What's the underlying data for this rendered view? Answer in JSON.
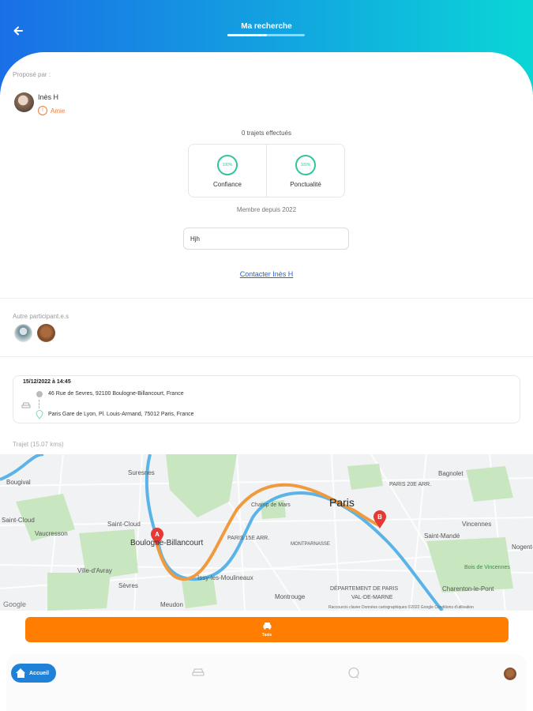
{
  "header": {
    "title": "Ma recherche",
    "back_icon": "arrow-left-icon"
  },
  "proposer": {
    "label": "Proposé par :",
    "name": "Inès H",
    "tag": "Amie",
    "tag_color": "#f07a3a"
  },
  "stats": {
    "trips_done": "0 trajets effectués",
    "items": [
      {
        "value": "100%",
        "label": "Confiance"
      },
      {
        "value": "100%",
        "label": "Ponctualité"
      }
    ],
    "member_since": "Membre depuis 2022"
  },
  "message": {
    "value": "Hjh"
  },
  "contact": {
    "label": "Contacter Inès H"
  },
  "participants": {
    "label": "Autre participant.e.s"
  },
  "trip": {
    "datetime": "15/12/2022 à 14:45",
    "from": "46 Rue de Sevres, 92100 Boulogne-Billancourt, France",
    "to": "Paris Gare de Lyon, Pl. Louis-Armand, 75012 Paris, France",
    "route_label": "Trajet (15.07 kms)"
  },
  "map": {
    "labels": {
      "bougival": "Bougival",
      "suresnes": "Suresnes",
      "saint_cloud": "Saint-Cloud",
      "vaucresson": "Vaucresson",
      "boulogne": "Boulogne-Billancourt",
      "ville_davray": "Ville-d'Avray",
      "sevres": "Sèvres",
      "meudon": "Meudon",
      "issy": "Issy-les-Moulineaux",
      "champ_de_mars": "Champ de Mars",
      "paris": "Paris",
      "paris15": "PARIS 15E ARR.",
      "paris20": "PARIS 20E ARR.",
      "bagnolet": "Bagnolet",
      "vincennes": "Vincennes",
      "saint_mande": "Saint-Mandé",
      "nogent": "Nogent-",
      "charenton": "Charenton-le-Pont",
      "dept": "DÉPARTEMENT DE PARIS",
      "montrouge": "Montrouge",
      "montparnasse": "MONTPARNASSE",
      "bois_vincennes": "Bois de Vincennes",
      "val_de_marne": "VAL-DE-MARNE",
      "footer": "Raccourcis clavier   Données cartographiques ©2022 Google   Conditions d'utilisation",
      "google": "Google"
    },
    "marker_a": "A",
    "marker_b": "B",
    "route_color": "#f09a3e",
    "water_color": "#5ab4e8",
    "park_color": "#c8e6c0"
  },
  "taxi_button": {
    "label": "Taxis",
    "icon": "car-icon",
    "color": "#ff7d00"
  },
  "nav": {
    "home_label": "Accueil",
    "home_icon": "home-icon",
    "carpool_icon": "car-group-icon",
    "chat_icon": "chat-bubble-icon",
    "accent": "#1f82d8"
  }
}
